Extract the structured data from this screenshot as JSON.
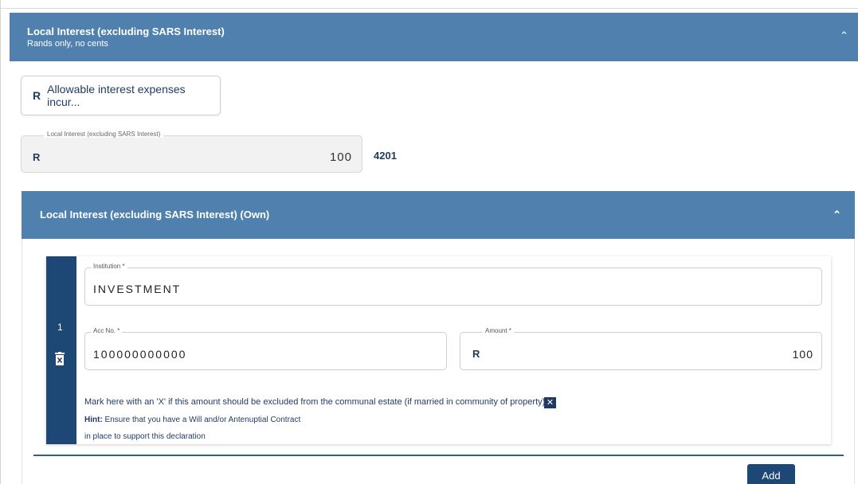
{
  "main_section": {
    "title": "Local Interest (excluding SARS Interest)",
    "subtitle": "Rands only, no cents"
  },
  "allowable_interest_button": {
    "currency": "R",
    "label": "Allowable interest expenses incur..."
  },
  "local_interest_total": {
    "label": "Local Interest (excluding SARS Interest)",
    "currency": "R",
    "value": "100",
    "code": "4201"
  },
  "own_section": {
    "title": "Local Interest (excluding SARS Interest) (Own)"
  },
  "entry": {
    "index": "1",
    "institution_label": "Institution *",
    "institution_value": "INVESTMENT",
    "acc_label": "Acc No. *",
    "acc_value": "100000000000",
    "amount_label": "Amount *",
    "amount_currency": "R",
    "amount_value": "100",
    "exclude_text": "Mark here with an 'X' if this amount should be excluded from the communal estate (if married in community of property)",
    "exclude_checked": true,
    "hint_prefix": "Hint:",
    "hint_line1": " Ensure that you have a Will and/or Antenuptial Contract",
    "hint_line2": "in place to support this declaration"
  },
  "add_button_label": "Add",
  "colors": {
    "header_bg": "#5080ad",
    "navy": "#1d4775",
    "text_navy": "#1e3a5f"
  },
  "icons": {
    "collapse": "chevron-up-icon",
    "delete": "trash-icon",
    "checkbox": "x-checkbox-icon"
  }
}
